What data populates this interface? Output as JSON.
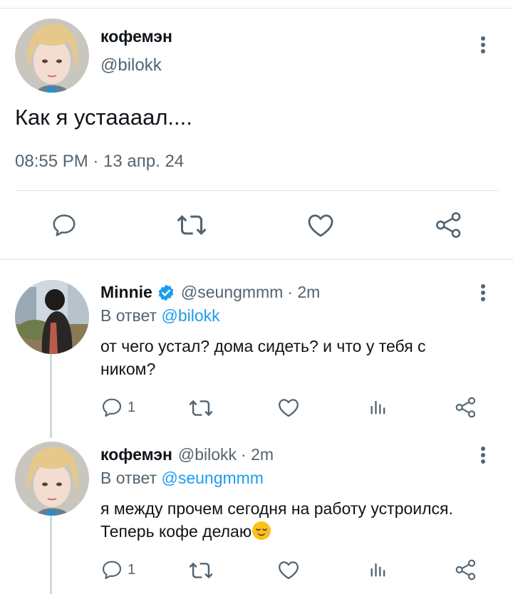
{
  "main_tweet": {
    "name": "кофемэн",
    "handle": "@bilokk",
    "text": "Как я устаааал....",
    "meta": "08:55 PM · 13 апр. 24"
  },
  "replies": [
    {
      "name": "Minnie",
      "verified": true,
      "handle": "@seungmmm",
      "time": "· 2m",
      "reply_prefix": "В ответ",
      "reply_to": "@bilokk",
      "text": "от чего устал? дома сидеть? и что у тебя с ником?",
      "reply_count": "1"
    },
    {
      "name": "кофемэн",
      "verified": false,
      "handle": "@bilokk",
      "time": "· 2m",
      "reply_prefix": "В ответ",
      "reply_to": "@seungmmm",
      "text": "я между прочем сегодня на работу устроился. Теперь кофе делаю",
      "emoji": "relieved-face-emoji",
      "reply_count": "1"
    }
  ],
  "icons": [
    "reply-icon",
    "retweet-icon",
    "like-icon",
    "share-icon",
    "analytics-icon",
    "more-icon",
    "verified-badge-icon"
  ],
  "colors": {
    "accent": "#1d9bf0",
    "muted": "#536471",
    "text": "#0f1419"
  }
}
